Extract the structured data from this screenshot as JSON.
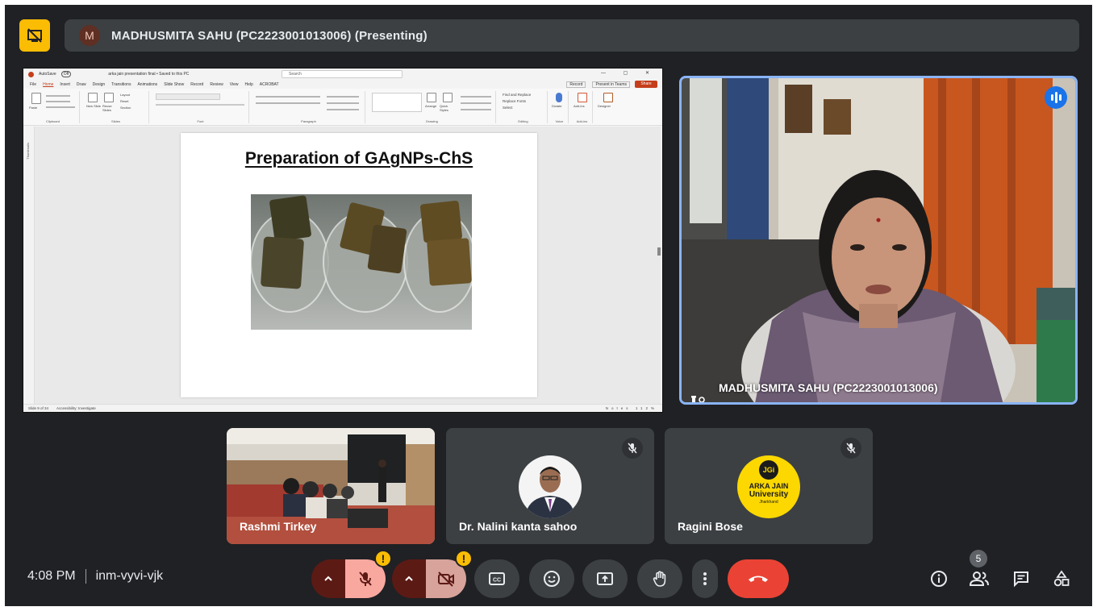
{
  "top_bar": {
    "avatar_letter": "M",
    "presenting_text": "MADHUSMITA SAHU (PC2223001013006) (Presenting)",
    "accent_color": "#fbbc04"
  },
  "shared_screen": {
    "titlebar": {
      "autosave": "AutoSave",
      "toggle": "Off",
      "file_name": "arka jain presentation final • Saved to this PC",
      "search_placeholder": "Search"
    },
    "menu_tabs": [
      "File",
      "Home",
      "Insert",
      "Draw",
      "Design",
      "Transitions",
      "Animations",
      "Slide Show",
      "Record",
      "Review",
      "View",
      "Help",
      "ACROBAT"
    ],
    "ribbon_buttons": {
      "record": "Record",
      "present_in_teams": "Present in Teams",
      "share": "Share"
    },
    "ribbon_groups": [
      "Clipboard",
      "Slides",
      "Font",
      "Paragraph",
      "Drawing",
      "Editing",
      "Voice",
      "Add-ins",
      "Designer"
    ],
    "ribbon_items": {
      "paste": "Paste",
      "new_slide": "New Slide",
      "reuse_slides": "Reuse Slides",
      "layout": "Layout",
      "reset": "Reset",
      "section": "Section",
      "find_replace": "Find and Replace",
      "replace_fonts": "Replace Fonts",
      "select": "Select",
      "dictate": "Dictate",
      "add_ins": "Add-ins",
      "designer": "Designer",
      "arrange": "Arrange",
      "quick_styles": "Quick Styles"
    },
    "thumbnails_label": "Thumbnails",
    "slide": {
      "title": "Preparation of GAgNPs-ChS"
    },
    "status_bar": {
      "slide_count": "Slide 9 of 34",
      "accessibility": "Accessibility: Investigate",
      "notes": "Notes",
      "zoom": "112%"
    }
  },
  "presenter_tile": {
    "name": "MADHUSMITA SAHU (PC2223001013006)",
    "talking_color": "#1a73e8",
    "border_color": "#8ab4f8"
  },
  "participants": [
    {
      "name": "Rashmi Tirkey",
      "muted": false
    },
    {
      "name": "Dr. Nalini kanta sahoo",
      "muted": true
    },
    {
      "name": "Ragini Bose",
      "muted": true,
      "logo": {
        "line1": "JGi",
        "line2": "ARKA JAIN",
        "line3": "University",
        "line4": "Jharkhand"
      }
    }
  ],
  "bottom_bar": {
    "time": "4:08 PM",
    "meeting_code": "inm-vyvi-vjk",
    "warning_glyph": "!",
    "participant_count": "5",
    "end_call_color": "#ea4335"
  },
  "icons": {
    "present_toggle": "present-off-icon",
    "mic": "mic-off-icon",
    "camera": "camera-off-icon",
    "captions": "captions-icon",
    "emoji": "emoji-icon",
    "present": "present-screen-icon",
    "hand": "raise-hand-icon",
    "more": "more-vert-icon",
    "end": "call-end-icon",
    "info": "info-icon",
    "people": "people-icon",
    "chat": "chat-icon",
    "activities": "activities-icon"
  }
}
